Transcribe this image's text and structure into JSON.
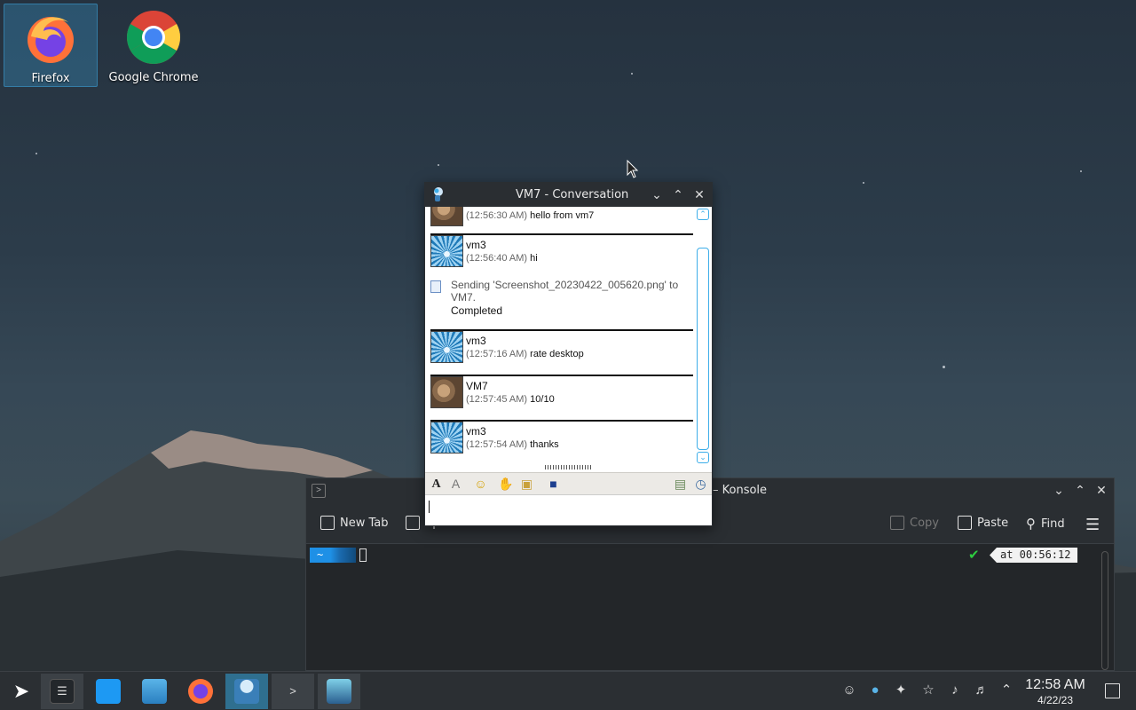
{
  "desktop": {
    "icons": [
      {
        "label": "Firefox",
        "icon": "firefox-icon",
        "selected": true
      },
      {
        "label": "Google Chrome",
        "icon": "chrome-icon",
        "selected": false
      }
    ]
  },
  "conversation": {
    "title": "VM7 - Conversation",
    "messages": [
      {
        "sender": "",
        "time": "(12:56:30 AM)",
        "text": "hello from vm7",
        "avatar": "cat-avatar"
      },
      {
        "sender": "vm3",
        "time": "(12:56:40 AM)",
        "text": "hi",
        "avatar": "pinwheel-avatar"
      },
      {
        "sender": "vm3",
        "time": "(12:57:16 AM)",
        "text": "rate desktop",
        "avatar": "pinwheel-avatar"
      },
      {
        "sender": "VM7",
        "time": "(12:57:45 AM)",
        "text": "10/10",
        "avatar": "cat-avatar"
      },
      {
        "sender": "vm3",
        "time": "(12:57:54 AM)",
        "text": "thanks",
        "avatar": "pinwheel-avatar"
      }
    ],
    "transfer": {
      "text": "Sending 'Screenshot_20230422_005620.png' to VM7.",
      "status": "Completed"
    },
    "input_value": ""
  },
  "konsole": {
    "title": "– Konsole",
    "toolbar": {
      "new_tab": "New Tab",
      "split_view": "Split View",
      "copy": "Copy",
      "paste": "Paste",
      "find": "Find"
    },
    "prompt_dir": "~",
    "time_label": "at 00:56:12"
  },
  "taskbar": {
    "time": "12:58 AM",
    "date": "4/22/23"
  },
  "colors": {
    "accent": "#3daee9",
    "panel": "#2b2f33",
    "window_title": "#2a2e32"
  }
}
